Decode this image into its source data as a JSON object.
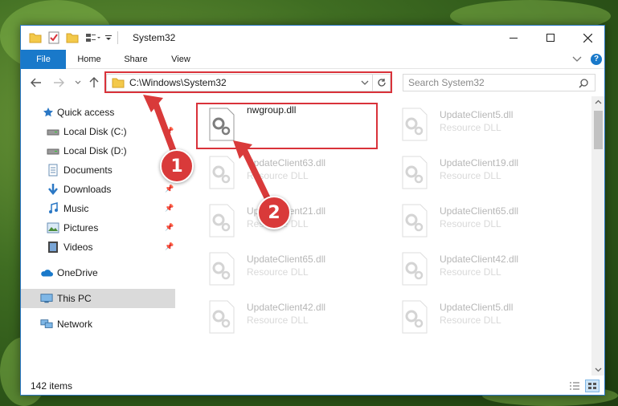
{
  "window": {
    "title": "System32"
  },
  "ribbon": {
    "tabs": [
      "File",
      "Home",
      "Share",
      "View"
    ]
  },
  "address": {
    "path": "C:\\Windows\\System32"
  },
  "search": {
    "placeholder": "Search System32"
  },
  "sidebar": {
    "items": [
      {
        "label": "Quick access",
        "icon": "star-icon",
        "pinned": false
      },
      {
        "label": "Local Disk (C:)",
        "icon": "drive-icon",
        "pinned": true
      },
      {
        "label": "Local Disk (D:)",
        "icon": "drive-icon",
        "pinned": false
      },
      {
        "label": "Documents",
        "icon": "documents-icon",
        "pinned": true
      },
      {
        "label": "Downloads",
        "icon": "downloads-icon",
        "pinned": true
      },
      {
        "label": "Music",
        "icon": "music-icon",
        "pinned": true
      },
      {
        "label": "Pictures",
        "icon": "pictures-icon",
        "pinned": true
      },
      {
        "label": "Videos",
        "icon": "videos-icon",
        "pinned": true
      },
      {
        "label": "OneDrive",
        "icon": "onedrive-icon",
        "pinned": false
      },
      {
        "label": "This PC",
        "icon": "computer-icon",
        "pinned": false
      },
      {
        "label": "Network",
        "icon": "network-icon",
        "pinned": false
      }
    ]
  },
  "files": [
    {
      "name": "nwgroup.dll",
      "desc": ""
    },
    {
      "name": "UpdateClient5.dll",
      "desc": "Resource DLL"
    },
    {
      "name": "UpdateClient63.dll",
      "desc": "Resource DLL"
    },
    {
      "name": "UpdateClient19.dll",
      "desc": "Resource DLL"
    },
    {
      "name": "UpdateClient21.dll",
      "desc": "Resource DLL"
    },
    {
      "name": "UpdateClient65.dll",
      "desc": "Resource DLL"
    },
    {
      "name": "UpdateClient65.dll",
      "desc": "Resource DLL"
    },
    {
      "name": "UpdateClient42.dll",
      "desc": "Resource DLL"
    },
    {
      "name": "UpdateClient42.dll",
      "desc": "Resource DLL"
    },
    {
      "name": "UpdateClient5.dll",
      "desc": "Resource DLL"
    }
  ],
  "status": {
    "count": "142 items"
  },
  "annotations": {
    "step1": "1",
    "step2": "2"
  },
  "colors": {
    "accent": "#1979ca",
    "highlight": "#d9323a"
  }
}
